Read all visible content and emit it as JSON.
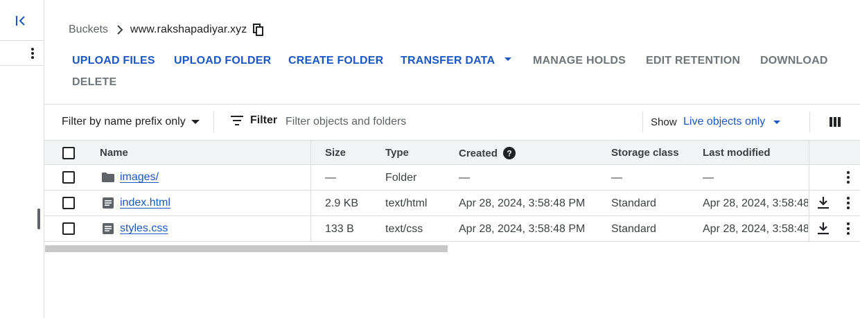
{
  "rail": {
    "collapse_icon": "collapse-left-icon",
    "menu_icon": "more-vert-icon"
  },
  "breadcrumb": {
    "root": "Buckets",
    "current": "www.rakshapadiyar.xyz",
    "copy_icon": "copy-icon"
  },
  "toolbar": {
    "upload_files": "UPLOAD FILES",
    "upload_folder": "UPLOAD FOLDER",
    "create_folder": "CREATE FOLDER",
    "transfer_data": "TRANSFER DATA",
    "manage_holds": "MANAGE HOLDS",
    "edit_retention": "EDIT RETENTION",
    "download": "DOWNLOAD",
    "delete": "DELETE"
  },
  "filter_bar": {
    "prefix_mode": "Filter by name prefix only",
    "filter_label": "Filter",
    "filter_placeholder": "Filter objects and folders",
    "show_label": "Show",
    "show_value": "Live objects only",
    "columns_icon": "view-columns-icon"
  },
  "table": {
    "headers": {
      "name": "Name",
      "size": "Size",
      "type": "Type",
      "created": "Created",
      "storage_class": "Storage class",
      "last_modified": "Last modified"
    },
    "rows": [
      {
        "icon": "folder-icon",
        "name": "images/",
        "size": "—",
        "type": "Folder",
        "created": "—",
        "storage_class": "—",
        "last_modified": "—",
        "downloadable": false
      },
      {
        "icon": "file-icon",
        "name": "index.html",
        "size": "2.9 KB",
        "type": "text/html",
        "created": "Apr 28, 2024, 3:58:48 PM",
        "storage_class": "Standard",
        "last_modified": "Apr 28, 2024, 3:58:48",
        "downloadable": true
      },
      {
        "icon": "file-icon",
        "name": "styles.css",
        "size": "133 B",
        "type": "text/css",
        "created": "Apr 28, 2024, 3:58:48 PM",
        "storage_class": "Standard",
        "last_modified": "Apr 28, 2024, 3:58:48",
        "downloadable": true
      }
    ]
  },
  "colors": {
    "accent": "#1a56c4",
    "disabled": "#70757a",
    "header_bg": "#f1f3f4",
    "border": "#dadce0"
  }
}
